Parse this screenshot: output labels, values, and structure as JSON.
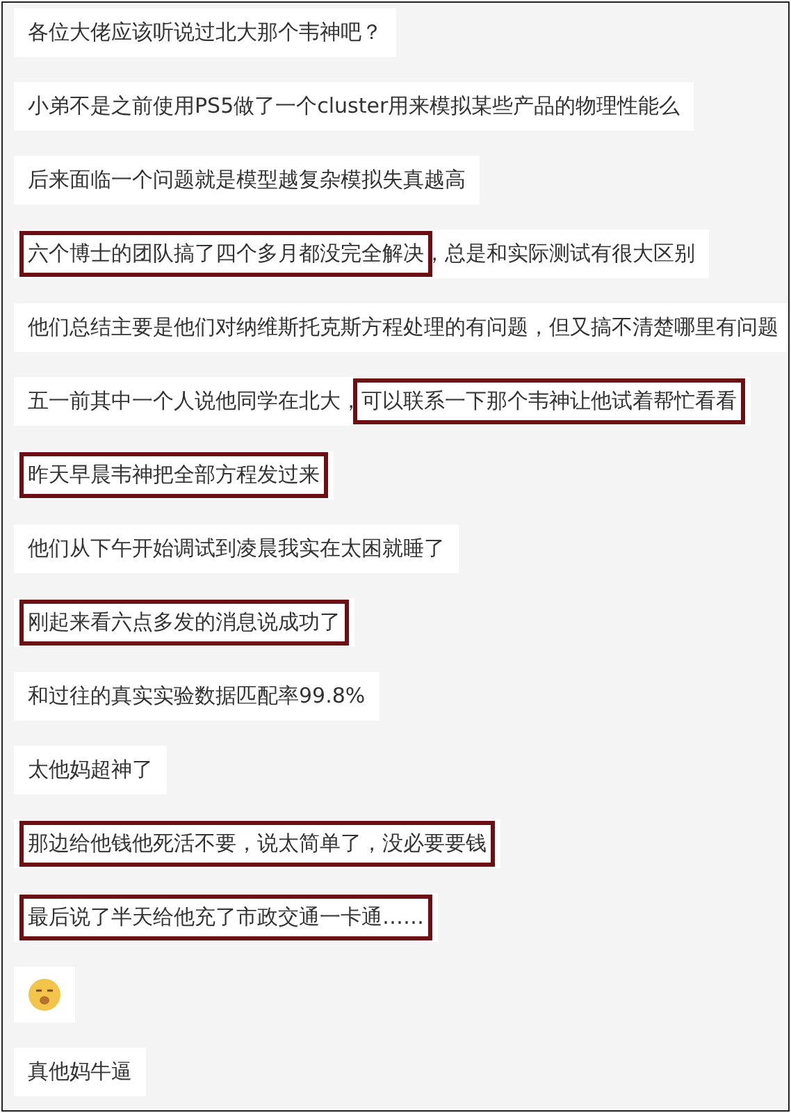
{
  "messages": [
    {
      "kind": "text",
      "parts": [
        {
          "text": "各位大佬应该听说过北大那个韦神吧？",
          "highlighted": false
        }
      ]
    },
    {
      "kind": "text",
      "parts": [
        {
          "text": "小弟不是之前使用PS5做了一个cluster用来模拟某些产品的物理性能么",
          "highlighted": false
        }
      ]
    },
    {
      "kind": "text",
      "parts": [
        {
          "text": "后来面临一个问题就是模型越复杂模拟失真越高",
          "highlighted": false
        }
      ]
    },
    {
      "kind": "text",
      "parts": [
        {
          "text": "六个博士的团队搞了四个多月都没完全解决",
          "highlighted": true
        },
        {
          "text": "，总是和实际测试有很大区别",
          "highlighted": false
        }
      ]
    },
    {
      "kind": "text",
      "parts": [
        {
          "text": "他们总结主要是他们对纳维斯托克斯方程处理的有问题，但又搞不清楚哪里有问题",
          "highlighted": false
        }
      ]
    },
    {
      "kind": "text",
      "parts": [
        {
          "text": "五一前其中一个人说他同学在北大，",
          "highlighted": false
        },
        {
          "text": "可以联系一下那个韦神让他试着帮忙看看",
          "highlighted": true
        }
      ]
    },
    {
      "kind": "text",
      "parts": [
        {
          "text": "昨天早晨韦神把全部方程发过来",
          "highlighted": true
        }
      ]
    },
    {
      "kind": "text",
      "parts": [
        {
          "text": "他们从下午开始调试到凌晨我实在太困就睡了",
          "highlighted": false
        }
      ]
    },
    {
      "kind": "text",
      "parts": [
        {
          "text": "刚起来看六点多发的消息说成功了",
          "highlighted": true
        }
      ]
    },
    {
      "kind": "text",
      "parts": [
        {
          "text": "和过往的真实实验数据匹配率99.8%",
          "highlighted": false
        }
      ]
    },
    {
      "kind": "text",
      "parts": [
        {
          "text": "太他妈超神了",
          "highlighted": false
        }
      ]
    },
    {
      "kind": "text",
      "parts": [
        {
          "text": "那边给他钱他死活不要，说太简单了，没必要要钱",
          "highlighted": true
        }
      ]
    },
    {
      "kind": "text",
      "parts": [
        {
          "text": "最后说了半天给他充了市政交通一卡通……",
          "highlighted": true
        }
      ]
    },
    {
      "kind": "emoji"
    },
    {
      "kind": "text",
      "parts": [
        {
          "text": "真他妈牛逼",
          "highlighted": false
        }
      ]
    }
  ]
}
